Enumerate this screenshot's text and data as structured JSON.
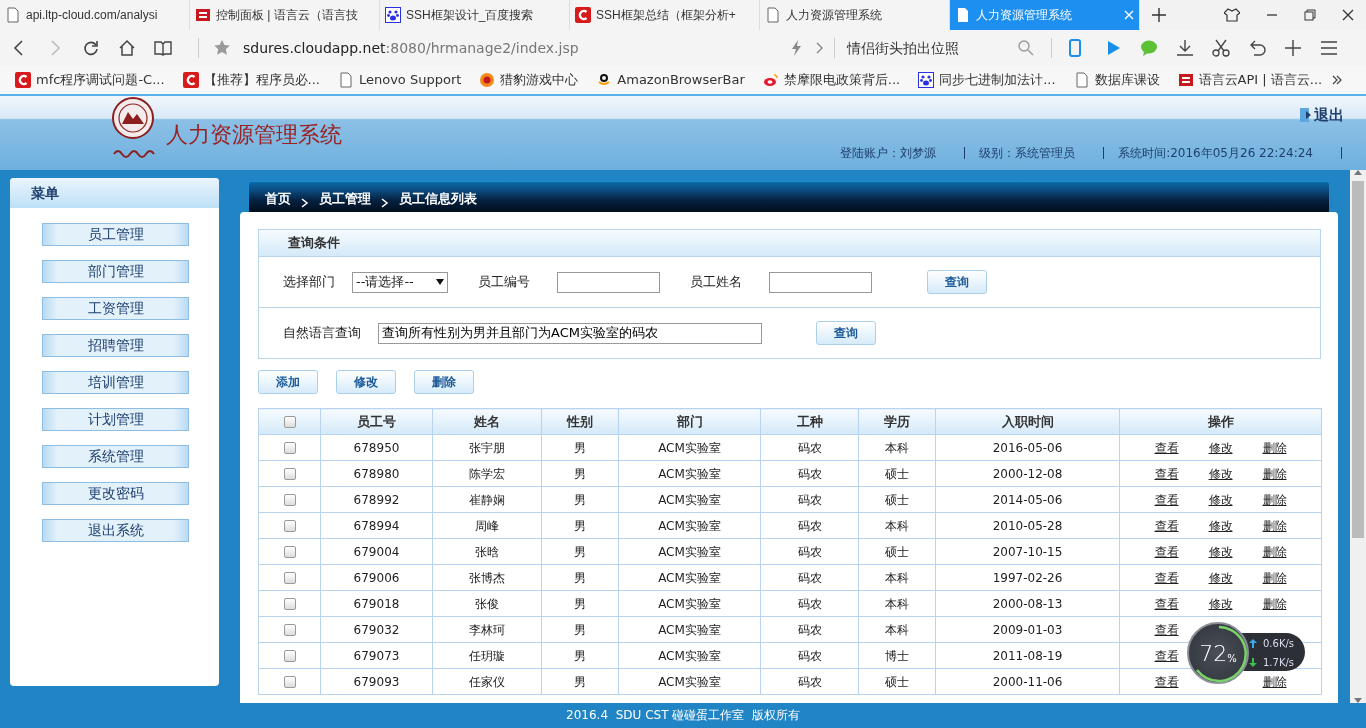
{
  "browser": {
    "tabs": [
      {
        "title": "api.ltp-cloud.com/analysi",
        "selected": false
      },
      {
        "title": "控制面板 | 语言云（语言技",
        "selected": false
      },
      {
        "title": "SSH框架设计_百度搜索",
        "selected": false
      },
      {
        "title": "SSH框架总结（框架分析+",
        "selected": false
      },
      {
        "title": "人力资源管理系统",
        "selected": false
      },
      {
        "title": "人力资源管理系统",
        "selected": true
      }
    ],
    "address": {
      "host": "sdures.cloudapp.net",
      "path": ":8080/hrmanage2/index.jsp"
    },
    "search": {
      "value": "情侣街头拍出位照"
    },
    "bookmarks": [
      {
        "title": "mfc程序调试问题-C..."
      },
      {
        "title": "【推荐】程序员必..."
      },
      {
        "title": "Lenovo Support"
      },
      {
        "title": "猎豹游戏中心"
      },
      {
        "title": "AmazonBrowserBar"
      },
      {
        "title": "禁摩限电政策背后..."
      },
      {
        "title": "同步七进制加法计..."
      },
      {
        "title": "数据库课设"
      },
      {
        "title": "语言云API | 语言云..."
      }
    ]
  },
  "header": {
    "title": "人力资源管理系统",
    "logout": "退出",
    "info": [
      "登陆账户：刘梦源",
      "级别：系统管理员",
      "系统时间:2016年05月26 22:24:24"
    ]
  },
  "sidebar": {
    "title": "菜单",
    "items": [
      "员工管理",
      "部门管理",
      "工资管理",
      "招聘管理",
      "培训管理",
      "计划管理",
      "系统管理",
      "更改密码",
      "退出系统"
    ]
  },
  "breadcrumb": [
    "首页",
    "员工管理",
    "员工信息列表"
  ],
  "query": {
    "title": "查询条件",
    "fields": [
      {
        "kind": "select",
        "label": "选择部门",
        "value": "--请选择--"
      },
      {
        "kind": "text",
        "label": "员工编号"
      },
      {
        "kind": "text",
        "label": "员工姓名"
      }
    ],
    "button": "查询",
    "nl": {
      "label": "自然语言查询",
      "value": "查询所有性别为男并且部门为ACM实验室的码农",
      "button": "查询"
    }
  },
  "actions": [
    "添加",
    "修改",
    "删除"
  ],
  "table": {
    "all_checked": false,
    "columns": [
      "员工号",
      "姓名",
      "性别",
      "部门",
      "工种",
      "学历",
      "入职时间",
      "操作"
    ],
    "rows": [
      {
        "checked": false,
        "cells": [
          "678950",
          "张宇朋",
          "男",
          "ACM实验室",
          "码农",
          "本科",
          "2016-05-06"
        ],
        "links": {
          "view": "查看",
          "edit": "修改",
          "delete": "删除"
        }
      },
      {
        "checked": false,
        "cells": [
          "678980",
          "陈学宏",
          "男",
          "ACM实验室",
          "码农",
          "硕士",
          "2000-12-08"
        ],
        "links": {
          "view": "查看",
          "edit": "修改",
          "delete": "删除"
        }
      },
      {
        "checked": false,
        "cells": [
          "678992",
          "崔静娴",
          "男",
          "ACM实验室",
          "码农",
          "硕士",
          "2014-05-06"
        ],
        "links": {
          "view": "查看",
          "edit": "修改",
          "delete": "删除"
        }
      },
      {
        "checked": false,
        "cells": [
          "678994",
          "周峰",
          "男",
          "ACM实验室",
          "码农",
          "本科",
          "2010-05-28"
        ],
        "links": {
          "view": "查看",
          "edit": "修改",
          "delete": "删除"
        }
      },
      {
        "checked": false,
        "cells": [
          "679004",
          "张晗",
          "男",
          "ACM实验室",
          "码农",
          "硕士",
          "2007-10-15"
        ],
        "links": {
          "view": "查看",
          "edit": "修改",
          "delete": "删除"
        }
      },
      {
        "checked": false,
        "cells": [
          "679006",
          "张博杰",
          "男",
          "ACM实验室",
          "码农",
          "本科",
          "1997-02-26"
        ],
        "links": {
          "view": "查看",
          "edit": "修改",
          "delete": "删除"
        }
      },
      {
        "checked": false,
        "cells": [
          "679018",
          "张俊",
          "男",
          "ACM实验室",
          "码农",
          "本科",
          "2000-08-13"
        ],
        "links": {
          "view": "查看",
          "edit": "修改",
          "delete": "删除"
        }
      },
      {
        "checked": false,
        "cells": [
          "679032",
          "李林珂",
          "男",
          "ACM实验室",
          "码农",
          "本科",
          "2009-01-03"
        ],
        "links": {
          "view": "查看"
        }
      },
      {
        "checked": false,
        "cells": [
          "679073",
          "任玥璇",
          "男",
          "ACM实验室",
          "码农",
          "博士",
          "2011-08-19"
        ],
        "links": {
          "view": "查看"
        }
      },
      {
        "checked": false,
        "cells": [
          "679093",
          "任家仪",
          "男",
          "ACM实验室",
          "码农",
          "硕士",
          "2000-11-06"
        ],
        "links": {
          "view": "查看",
          "delete": "删除"
        }
      }
    ]
  },
  "footer": "2016.4  SDU CST 碰碰蛋工作室  版权所有",
  "net_widget": {
    "percent": "72",
    "unit": "%",
    "up": "0.6K/s",
    "down": "1.7K/s"
  }
}
